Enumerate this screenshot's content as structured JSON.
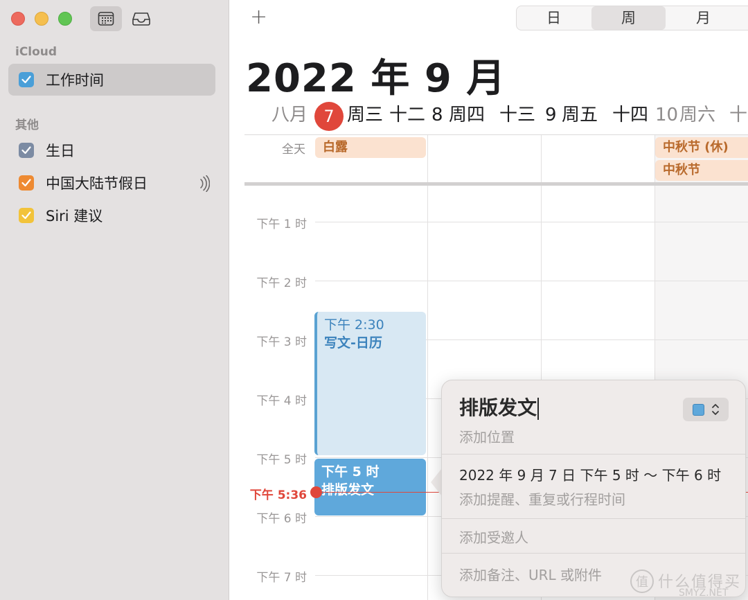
{
  "sidebar": {
    "section_icloud": "iCloud",
    "section_other": "其他",
    "calendars": [
      {
        "name": "工作时间",
        "color": "#4a9fd8",
        "checked": true,
        "selected": true
      },
      {
        "name": "生日",
        "color": "#7c8ba3",
        "checked": true
      },
      {
        "name": "中国大陆节假日",
        "color": "#ee8a32",
        "checked": true,
        "icon": "broadcast-icon"
      },
      {
        "name": "Siri 建议",
        "color": "#f2c33a",
        "checked": true
      }
    ]
  },
  "toolbar": {
    "add_label": "+",
    "views": [
      "日",
      "周",
      "月"
    ],
    "active_view": "周"
  },
  "header": {
    "month_title": "2022 年 9 月",
    "days": [
      {
        "num": "7",
        "weekday": "周三",
        "lunar": "十二",
        "today": true
      },
      {
        "num": "8",
        "weekday": "周四",
        "lunar": "十三"
      },
      {
        "num": "9",
        "weekday": "周五",
        "lunar": "十四"
      },
      {
        "num": "10",
        "weekday": "周六",
        "lunar": "十"
      }
    ],
    "lunar_month": "八月"
  },
  "allday": {
    "label": "全天",
    "events": [
      {
        "title": "白露"
      },
      {
        "title": "中秋节 (休)"
      },
      {
        "title": "中秋节"
      }
    ]
  },
  "hours": [
    "下午 1 时",
    "下午 2 时",
    "下午 3 时",
    "下午 4 时",
    "下午 5 时",
    "下午 6 时",
    "下午 7 时"
  ],
  "now_label": "下午 5:36",
  "events": [
    {
      "time": "下午 2:30",
      "title": "写文-日历"
    },
    {
      "time": "下午 5 时",
      "title": "排版发文"
    }
  ],
  "popover": {
    "title": "排版发文",
    "location_placeholder": "添加位置",
    "datetime": "2022 年 9 月 7 日  下午 5 时 ～ 下午 6 时",
    "alert_placeholder": "添加提醒、重复或行程时间",
    "invitees_placeholder": "添加受邀人",
    "notes_placeholder": "添加备注、URL 或附件",
    "color": "#5fa8db"
  },
  "watermark": {
    "icon_text": "值",
    "text": "什么值得买",
    "url": "SMYZ.NET"
  }
}
